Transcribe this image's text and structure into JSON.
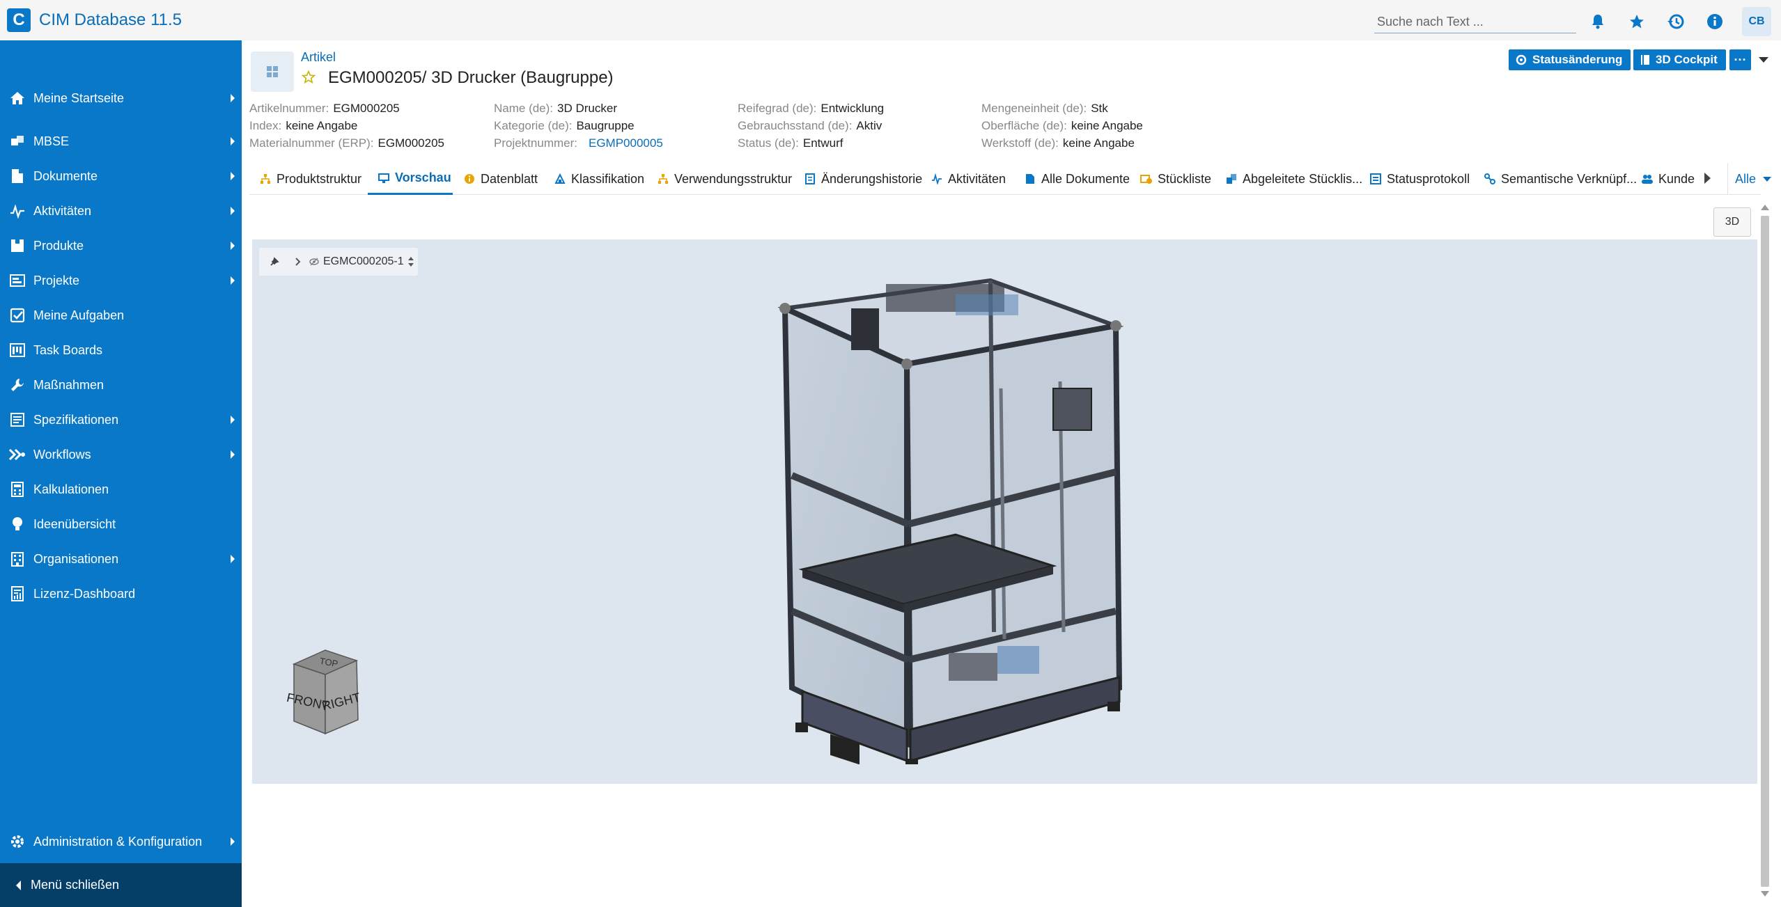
{
  "app": {
    "logo": "C",
    "title": "CIM Database 11.5"
  },
  "topbar": {
    "search_placeholder": "Suche nach Text ...",
    "icons": [
      "bell-icon",
      "star-icon",
      "history-icon",
      "info-icon"
    ],
    "avatar": "CB"
  },
  "sidebar": {
    "items": [
      {
        "label": "Meine Startseite",
        "icon": "home-icon",
        "has_submenu": true
      },
      {
        "label": "MBSE",
        "icon": "cubes-icon",
        "has_submenu": true
      },
      {
        "label": "Dokumente",
        "icon": "document-icon",
        "has_submenu": true
      },
      {
        "label": "Aktivitäten",
        "icon": "activity-icon",
        "has_submenu": true
      },
      {
        "label": "Produkte",
        "icon": "box-icon",
        "has_submenu": true
      },
      {
        "label": "Projekte",
        "icon": "project-icon",
        "has_submenu": true
      },
      {
        "label": "Meine Aufgaben",
        "icon": "check-square-icon",
        "has_submenu": false
      },
      {
        "label": "Task Boards",
        "icon": "board-icon",
        "has_submenu": false
      },
      {
        "label": "Maßnahmen",
        "icon": "wrench-icon",
        "has_submenu": false
      },
      {
        "label": "Spezifikationen",
        "icon": "spec-icon",
        "has_submenu": true
      },
      {
        "label": "Workflows",
        "icon": "workflow-icon",
        "has_submenu": true
      },
      {
        "label": "Kalkulationen",
        "icon": "calculator-icon",
        "has_submenu": false
      },
      {
        "label": "Ideenübersicht",
        "icon": "lightbulb-icon",
        "has_submenu": false
      },
      {
        "label": "Organisationen",
        "icon": "building-icon",
        "has_submenu": true
      },
      {
        "label": "Lizenz-Dashboard",
        "icon": "license-icon",
        "has_submenu": false
      }
    ],
    "admin": {
      "label": "Administration & Konfiguration",
      "icon": "gear-icon"
    },
    "close_label": "Menü schließen"
  },
  "header": {
    "type_label": "Artikel",
    "title": "EGM000205/ 3D Drucker (Baugruppe)",
    "buttons": {
      "status_change": "Statusänderung",
      "cockpit": "3D Cockpit",
      "more": "···"
    }
  },
  "attributes": {
    "col1": [
      {
        "label": "Artikelnummer:",
        "value": "EGM000205"
      },
      {
        "label": "Index:",
        "value": "keine Angabe"
      },
      {
        "label": "Materialnummer (ERP):",
        "value": "EGM000205"
      }
    ],
    "col2": [
      {
        "label": "Name (de):",
        "value": "3D Drucker"
      },
      {
        "label": "Kategorie (de):",
        "value": "Baugruppe"
      },
      {
        "label": "Projektnummer:",
        "value": "EGMP000005",
        "link": true
      }
    ],
    "col3": [
      {
        "label": "Reifegrad (de):",
        "value": "Entwicklung"
      },
      {
        "label": "Gebrauchsstand (de):",
        "value": "Aktiv"
      },
      {
        "label": "Status (de):",
        "value": "Entwurf"
      }
    ],
    "col4": [
      {
        "label": "Mengeneinheit (de):",
        "value": "Stk"
      },
      {
        "label": "Oberfläche (de):",
        "value": "keine Angabe"
      },
      {
        "label": "Werkstoff (de):",
        "value": "keine Angabe"
      }
    ]
  },
  "tabs": [
    {
      "label": "Produktstruktur",
      "icon": "structure-icon"
    },
    {
      "label": "Vorschau",
      "icon": "monitor-icon",
      "active": true
    },
    {
      "label": "Datenblatt",
      "icon": "info-circle-icon"
    },
    {
      "label": "Klassifikation",
      "icon": "classification-icon"
    },
    {
      "label": "Verwendungsstruktur",
      "icon": "structure-icon"
    },
    {
      "label": "Änderungshistorie",
      "icon": "history-doc-icon"
    },
    {
      "label": "Aktivitäten",
      "icon": "activity-icon"
    },
    {
      "label": "Alle Dokumente",
      "icon": "document-icon"
    },
    {
      "label": "Stückliste",
      "icon": "bom-icon"
    },
    {
      "label": "Abgeleitete Stücklis...",
      "icon": "derived-bom-icon"
    },
    {
      "label": "Statusprotokoll",
      "icon": "status-log-icon"
    },
    {
      "label": "Semantische Verknüpf...",
      "icon": "link-icon"
    },
    {
      "label": "Kunde",
      "icon": "customer-icon"
    }
  ],
  "tabs_all_label": "Alle",
  "viewer": {
    "mode_button": "3D",
    "toolbar_label": "EGMC000205-1",
    "cube": {
      "top": "TOP",
      "front": "FRONT",
      "right": "RIGHT"
    }
  },
  "colors": {
    "accent": "#0a78c8",
    "sidebar_dark": "#053e66",
    "viewer_bg": "#dde6ef"
  }
}
